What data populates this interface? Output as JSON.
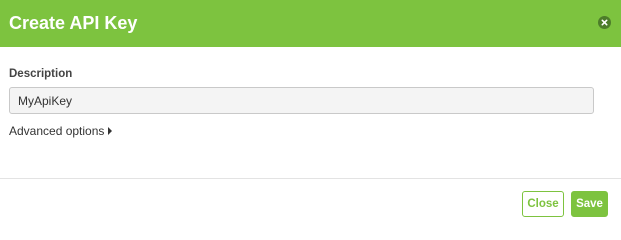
{
  "dialog": {
    "title": "Create API Key",
    "close_icon": "close-icon",
    "accent_color": "#7dc33f"
  },
  "form": {
    "description_label": "Description",
    "description_value": "MyApiKey",
    "advanced_label": "Advanced options",
    "advanced_icon": "caret-right-icon"
  },
  "footer": {
    "close_label": "Close",
    "save_label": "Save"
  }
}
